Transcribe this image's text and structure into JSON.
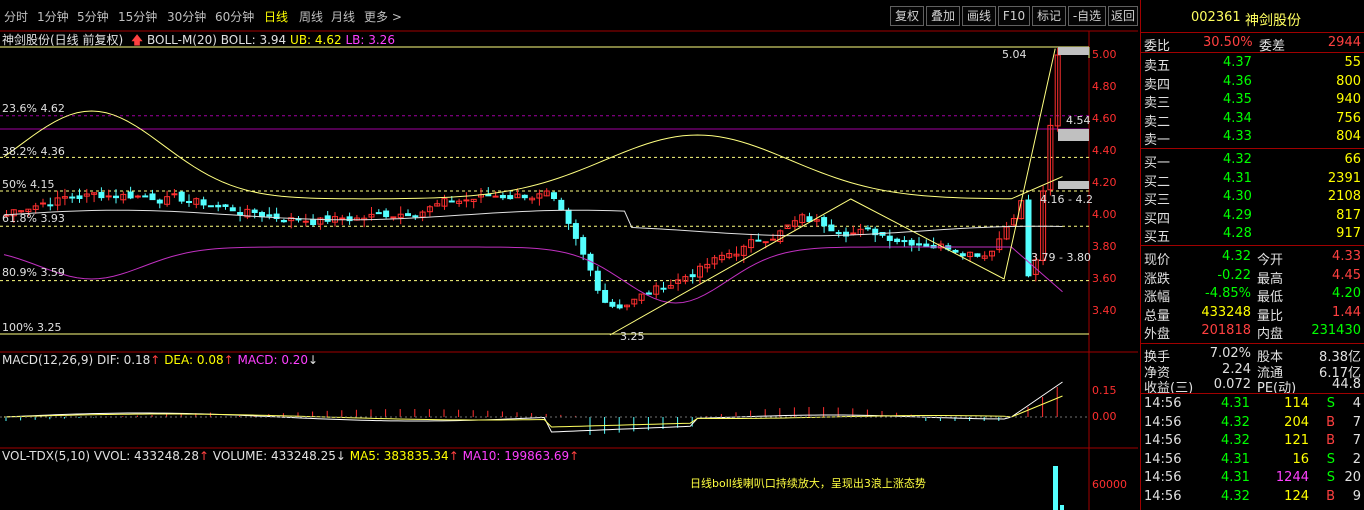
{
  "topbar": {
    "tabs": [
      "分时",
      "1分钟",
      "5分钟",
      "15分钟",
      "30分钟",
      "60分钟",
      "日线",
      "周线",
      "月线",
      "更多 >"
    ],
    "active_tab": "日线",
    "buttons": [
      "复权",
      "叠加",
      "画线",
      "F10",
      "标记",
      "-自选",
      "返回"
    ]
  },
  "indicators": {
    "boll_title": "神剑股份(日线 前复权)",
    "boll_params": "BOLL-M(20)",
    "boll_mid": "BOLL: 3.94",
    "boll_ub": "UB: 4.62",
    "boll_lb": "LB: 3.26",
    "macd_params": "MACD(12,26,9)",
    "macd_dif": "DIF: 0.18",
    "macd_dea": "DEA: 0.08",
    "macd_val": "MACD: 0.20",
    "vol_params": "VOL-TDX(5,10)",
    "vol_vvol": "VVOL: 433248.28",
    "vol_volume": "VOLUME: 433248.25",
    "vol_ma5": "MA5: 383835.34",
    "vol_ma10": "MA10: 199863.69"
  },
  "fib_levels": [
    "23.6% 4.62",
    "38.2% 4.36",
    "50% 4.15",
    "61.8% 3.93",
    "80.9% 3.59",
    "100% 3.25"
  ],
  "chart_labels": {
    "high": "5.04",
    "low": "3.25",
    "right_price": "4.54",
    "range1": "4.16 - 4.2",
    "range2": "3.79 - 3.80"
  },
  "price_axis": [
    "5.00",
    "4.80",
    "4.60",
    "4.40",
    "4.20",
    "4.00",
    "3.80",
    "3.60",
    "3.40"
  ],
  "macd_axis": [
    "0.15",
    "0.00"
  ],
  "vol_axis": [
    "60000"
  ],
  "annotation": "日线boll线喇叭口持续放大，呈现出3浪上涨态势",
  "quote": {
    "code": "002361",
    "name": "神剑股份",
    "weibi_label": "委比",
    "weibi": "30.50%",
    "weicha_label": "委差",
    "weicha": "2944",
    "asks": [
      {
        "label": "卖五",
        "price": "4.37",
        "vol": "55"
      },
      {
        "label": "卖四",
        "price": "4.36",
        "vol": "800"
      },
      {
        "label": "卖三",
        "price": "4.35",
        "vol": "940"
      },
      {
        "label": "卖二",
        "price": "4.34",
        "vol": "756"
      },
      {
        "label": "卖一",
        "price": "4.33",
        "vol": "804"
      }
    ],
    "bids": [
      {
        "label": "买一",
        "price": "4.32",
        "vol": "66"
      },
      {
        "label": "买二",
        "price": "4.31",
        "vol": "2391"
      },
      {
        "label": "买三",
        "price": "4.30",
        "vol": "2108"
      },
      {
        "label": "买四",
        "price": "4.29",
        "vol": "817"
      },
      {
        "label": "买五",
        "price": "4.28",
        "vol": "917"
      }
    ],
    "stats": [
      {
        "l1": "现价",
        "v1": "4.32",
        "l2": "今开",
        "v2": "4.33"
      },
      {
        "l1": "涨跌",
        "v1": "-0.22",
        "l2": "最高",
        "v2": "4.45"
      },
      {
        "l1": "涨幅",
        "v1": "-4.85%",
        "l2": "最低",
        "v2": "4.20"
      },
      {
        "l1": "总量",
        "v1": "433248",
        "l2": "量比",
        "v2": "1.44"
      },
      {
        "l1": "外盘",
        "v1": "201818",
        "l2": "内盘",
        "v2": "231430"
      }
    ],
    "fund": [
      {
        "l1": "换手",
        "v1": "7.02%",
        "l2": "股本",
        "v2": "8.38亿"
      },
      {
        "l1": "净资",
        "v1": "2.24",
        "l2": "流通",
        "v2": "6.17亿"
      },
      {
        "l1": "收益(三)",
        "v1": "0.072",
        "l2": "PE(动)",
        "v2": "44.8"
      }
    ],
    "ticks": [
      {
        "time": "14:56",
        "price": "4.31",
        "vol": "114",
        "bs": "S",
        "n": "4"
      },
      {
        "time": "14:56",
        "price": "4.32",
        "vol": "204",
        "bs": "B",
        "n": "7"
      },
      {
        "time": "14:56",
        "price": "4.32",
        "vol": "121",
        "bs": "B",
        "n": "7"
      },
      {
        "time": "14:56",
        "price": "4.31",
        "vol": "16",
        "bs": "S",
        "n": "2"
      },
      {
        "time": "14:56",
        "price": "4.31",
        "vol": "1244",
        "bs": "S",
        "n": "20"
      },
      {
        "time": "14:56",
        "price": "4.32",
        "vol": "124",
        "bs": "B",
        "n": "9"
      }
    ]
  }
}
